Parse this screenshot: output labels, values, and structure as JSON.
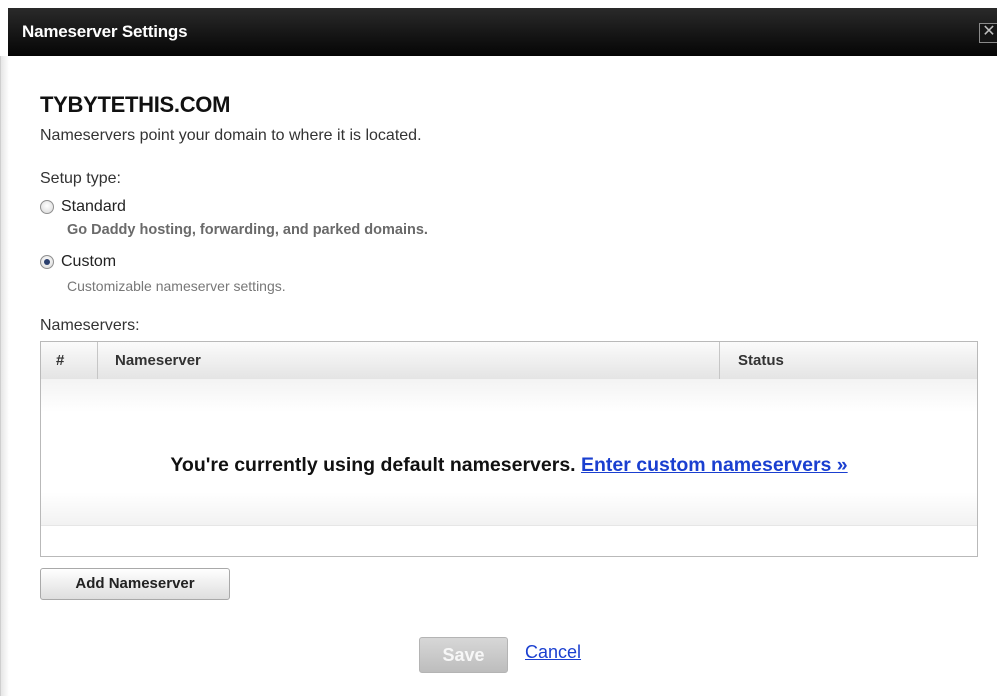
{
  "dialog": {
    "title": "Nameserver Settings",
    "close_glyph": "✕"
  },
  "domain": {
    "name": "TYBYTETHIS.COM",
    "description": "Nameservers point your domain to where it is located."
  },
  "setup": {
    "label": "Setup type:",
    "options": [
      {
        "label": "Standard",
        "description": "Go Daddy hosting, forwarding, and parked domains.",
        "selected": false
      },
      {
        "label": "Custom",
        "description": "Customizable nameserver settings.",
        "selected": true
      }
    ]
  },
  "nameservers": {
    "label": "Nameservers:",
    "columns": [
      "#",
      "Nameserver",
      "Status"
    ],
    "empty_message": "You're currently using default nameservers.",
    "enter_custom_link": "Enter custom nameservers »"
  },
  "buttons": {
    "add_nameserver": "Add Nameserver",
    "save": "Save",
    "cancel": "Cancel"
  },
  "colors": {
    "titlebar": "#050505",
    "link": "#1a3fd0",
    "disabled_button": "#c8c8c8"
  }
}
